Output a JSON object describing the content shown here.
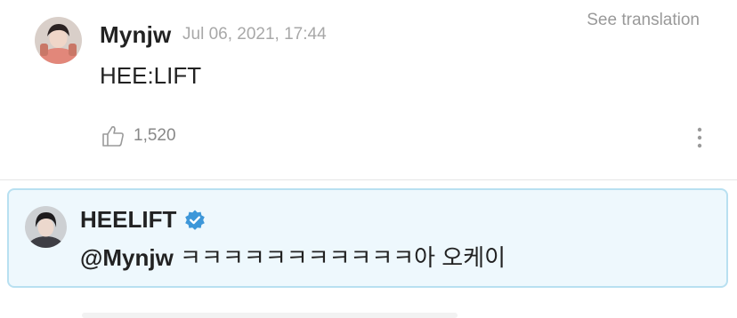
{
  "comment": {
    "author": "Mynjw",
    "timestamp": "Jul 06, 2021, 17:44",
    "translate_label": "See translation",
    "body": "HEE:LIFT",
    "likes": "1,520",
    "icons": {
      "avatar": "avatar",
      "like": "thumbs-up-icon",
      "more": "more-vertical-icon"
    }
  },
  "reply": {
    "author": "HEELIFT",
    "mention": "@Mynjw",
    "text": "ㅋㅋㅋㅋㅋㅋㅋㅋㅋㅋㅋ아 오케이",
    "icons": {
      "avatar": "avatar",
      "verified": "verified-badge-icon"
    }
  },
  "colors": {
    "reply_background": "#eef8fd",
    "reply_border": "#b8e0f1",
    "verified": "#3d97d9"
  }
}
